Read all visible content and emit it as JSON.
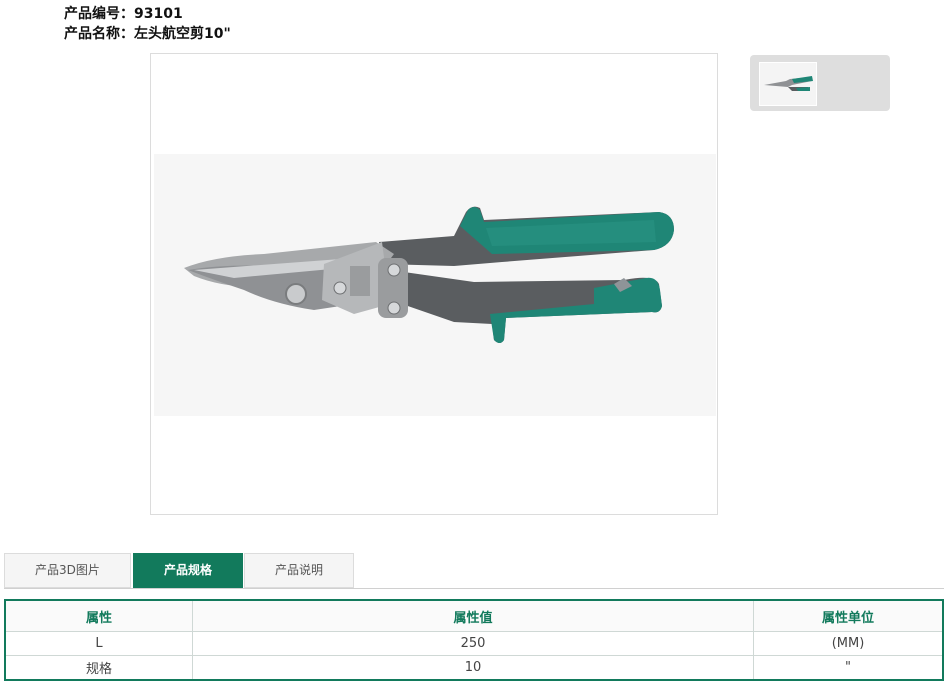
{
  "product": {
    "code_label": "产品编号：",
    "code_value": "93101",
    "name_label": "产品名称：",
    "name_value": "左头航空剪10\""
  },
  "tabs": [
    {
      "label": "产品3D图片",
      "active": false
    },
    {
      "label": "产品规格",
      "active": true
    },
    {
      "label": "产品说明",
      "active": false
    }
  ],
  "spec_table": {
    "headers": [
      "属性",
      "属性值",
      "属性单位"
    ],
    "rows": [
      [
        "L",
        "250",
        "(MM)"
      ],
      [
        "规格",
        "10",
        "\""
      ]
    ]
  },
  "colors": {
    "accent": "#127a5c",
    "handle_green": "#1f8676",
    "handle_gray": "#5a5d60"
  }
}
